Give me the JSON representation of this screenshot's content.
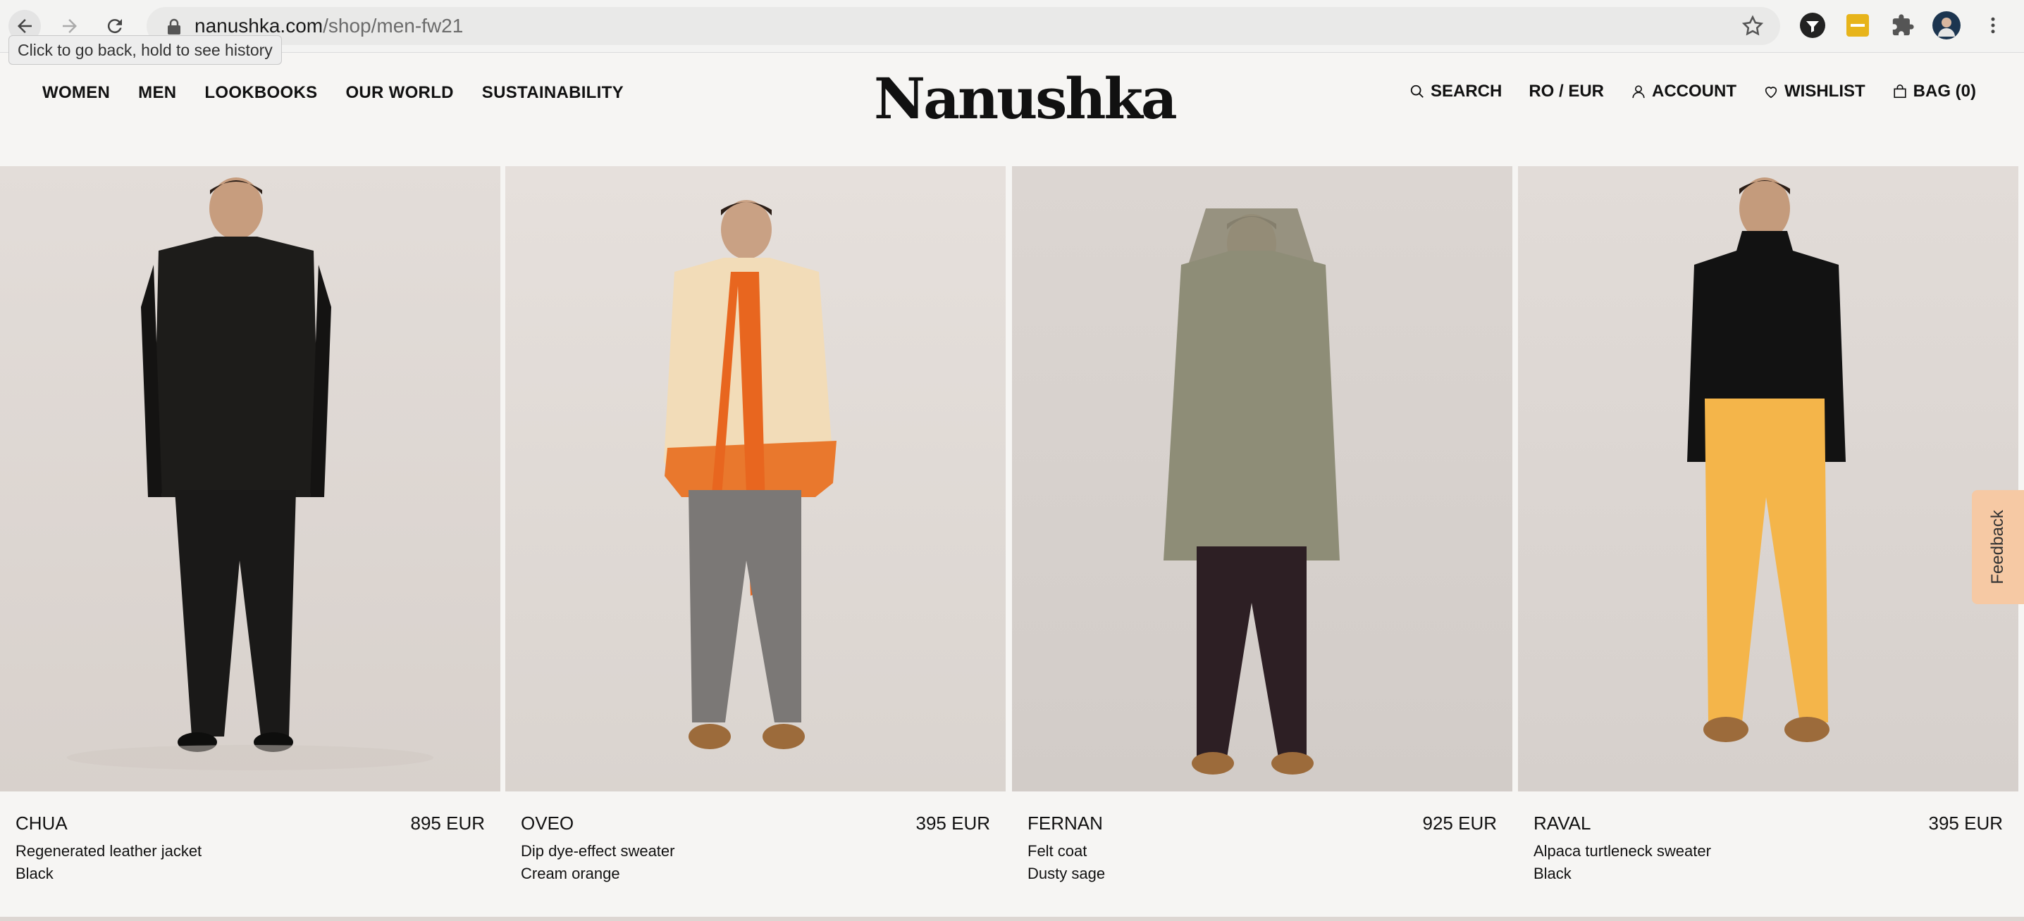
{
  "browser": {
    "url_host": "nanushka.com",
    "url_path": "/shop/men-fw21",
    "tooltip": "Click to go back, hold to see history"
  },
  "site": {
    "logo": "Nanushka",
    "nav": [
      "WOMEN",
      "MEN",
      "LOOKBOOKS",
      "OUR WORLD",
      "SUSTAINABILITY"
    ],
    "search": "SEARCH",
    "region": "RO / EUR",
    "account": "ACCOUNT",
    "wishlist": "WISHLIST",
    "bag": "BAG (0)"
  },
  "products": [
    {
      "name": "CHUA",
      "price": "895 EUR",
      "description": "Regenerated leather jacket",
      "color": "Black"
    },
    {
      "name": "OVEO",
      "price": "395 EUR",
      "description": "Dip dye-effect sweater",
      "color": "Cream orange"
    },
    {
      "name": "FERNAN",
      "price": "925 EUR",
      "description": "Felt coat",
      "color": "Dusty sage"
    },
    {
      "name": "RAVAL",
      "price": "395 EUR",
      "description": "Alpaca turtleneck sweater",
      "color": "Black"
    }
  ],
  "feedback": "Feedback"
}
